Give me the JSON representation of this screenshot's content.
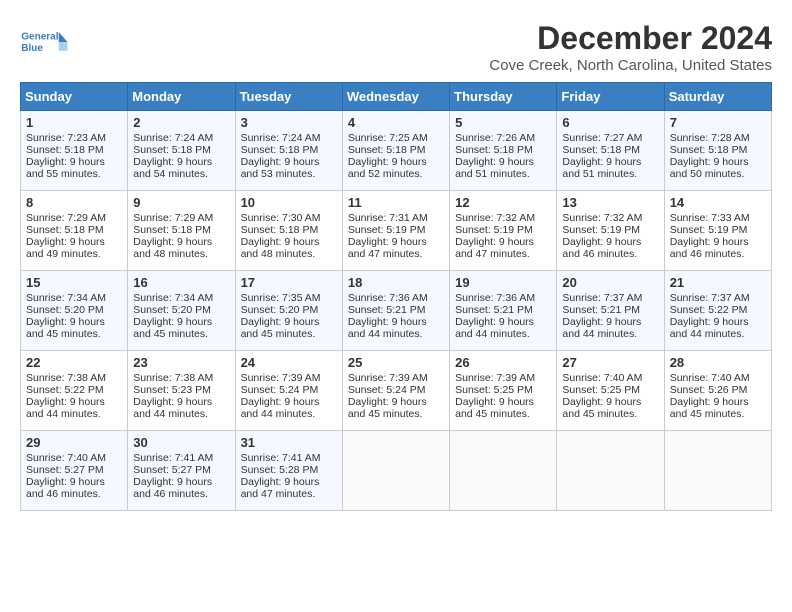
{
  "header": {
    "logo_line1": "General",
    "logo_line2": "Blue",
    "month": "December 2024",
    "location": "Cove Creek, North Carolina, United States"
  },
  "days_of_week": [
    "Sunday",
    "Monday",
    "Tuesday",
    "Wednesday",
    "Thursday",
    "Friday",
    "Saturday"
  ],
  "weeks": [
    [
      {
        "day": 1,
        "sunrise": "7:23 AM",
        "sunset": "5:18 PM",
        "daylight": "9 hours and 55 minutes."
      },
      {
        "day": 2,
        "sunrise": "7:24 AM",
        "sunset": "5:18 PM",
        "daylight": "9 hours and 54 minutes."
      },
      {
        "day": 3,
        "sunrise": "7:24 AM",
        "sunset": "5:18 PM",
        "daylight": "9 hours and 53 minutes."
      },
      {
        "day": 4,
        "sunrise": "7:25 AM",
        "sunset": "5:18 PM",
        "daylight": "9 hours and 52 minutes."
      },
      {
        "day": 5,
        "sunrise": "7:26 AM",
        "sunset": "5:18 PM",
        "daylight": "9 hours and 51 minutes."
      },
      {
        "day": 6,
        "sunrise": "7:27 AM",
        "sunset": "5:18 PM",
        "daylight": "9 hours and 51 minutes."
      },
      {
        "day": 7,
        "sunrise": "7:28 AM",
        "sunset": "5:18 PM",
        "daylight": "9 hours and 50 minutes."
      }
    ],
    [
      {
        "day": 8,
        "sunrise": "7:29 AM",
        "sunset": "5:18 PM",
        "daylight": "9 hours and 49 minutes."
      },
      {
        "day": 9,
        "sunrise": "7:29 AM",
        "sunset": "5:18 PM",
        "daylight": "9 hours and 48 minutes."
      },
      {
        "day": 10,
        "sunrise": "7:30 AM",
        "sunset": "5:18 PM",
        "daylight": "9 hours and 48 minutes."
      },
      {
        "day": 11,
        "sunrise": "7:31 AM",
        "sunset": "5:19 PM",
        "daylight": "9 hours and 47 minutes."
      },
      {
        "day": 12,
        "sunrise": "7:32 AM",
        "sunset": "5:19 PM",
        "daylight": "9 hours and 47 minutes."
      },
      {
        "day": 13,
        "sunrise": "7:32 AM",
        "sunset": "5:19 PM",
        "daylight": "9 hours and 46 minutes."
      },
      {
        "day": 14,
        "sunrise": "7:33 AM",
        "sunset": "5:19 PM",
        "daylight": "9 hours and 46 minutes."
      }
    ],
    [
      {
        "day": 15,
        "sunrise": "7:34 AM",
        "sunset": "5:20 PM",
        "daylight": "9 hours and 45 minutes."
      },
      {
        "day": 16,
        "sunrise": "7:34 AM",
        "sunset": "5:20 PM",
        "daylight": "9 hours and 45 minutes."
      },
      {
        "day": 17,
        "sunrise": "7:35 AM",
        "sunset": "5:20 PM",
        "daylight": "9 hours and 45 minutes."
      },
      {
        "day": 18,
        "sunrise": "7:36 AM",
        "sunset": "5:21 PM",
        "daylight": "9 hours and 44 minutes."
      },
      {
        "day": 19,
        "sunrise": "7:36 AM",
        "sunset": "5:21 PM",
        "daylight": "9 hours and 44 minutes."
      },
      {
        "day": 20,
        "sunrise": "7:37 AM",
        "sunset": "5:21 PM",
        "daylight": "9 hours and 44 minutes."
      },
      {
        "day": 21,
        "sunrise": "7:37 AM",
        "sunset": "5:22 PM",
        "daylight": "9 hours and 44 minutes."
      }
    ],
    [
      {
        "day": 22,
        "sunrise": "7:38 AM",
        "sunset": "5:22 PM",
        "daylight": "9 hours and 44 minutes."
      },
      {
        "day": 23,
        "sunrise": "7:38 AM",
        "sunset": "5:23 PM",
        "daylight": "9 hours and 44 minutes."
      },
      {
        "day": 24,
        "sunrise": "7:39 AM",
        "sunset": "5:24 PM",
        "daylight": "9 hours and 44 minutes."
      },
      {
        "day": 25,
        "sunrise": "7:39 AM",
        "sunset": "5:24 PM",
        "daylight": "9 hours and 45 minutes."
      },
      {
        "day": 26,
        "sunrise": "7:39 AM",
        "sunset": "5:25 PM",
        "daylight": "9 hours and 45 minutes."
      },
      {
        "day": 27,
        "sunrise": "7:40 AM",
        "sunset": "5:25 PM",
        "daylight": "9 hours and 45 minutes."
      },
      {
        "day": 28,
        "sunrise": "7:40 AM",
        "sunset": "5:26 PM",
        "daylight": "9 hours and 45 minutes."
      }
    ],
    [
      {
        "day": 29,
        "sunrise": "7:40 AM",
        "sunset": "5:27 PM",
        "daylight": "9 hours and 46 minutes."
      },
      {
        "day": 30,
        "sunrise": "7:41 AM",
        "sunset": "5:27 PM",
        "daylight": "9 hours and 46 minutes."
      },
      {
        "day": 31,
        "sunrise": "7:41 AM",
        "sunset": "5:28 PM",
        "daylight": "9 hours and 47 minutes."
      },
      null,
      null,
      null,
      null
    ]
  ]
}
